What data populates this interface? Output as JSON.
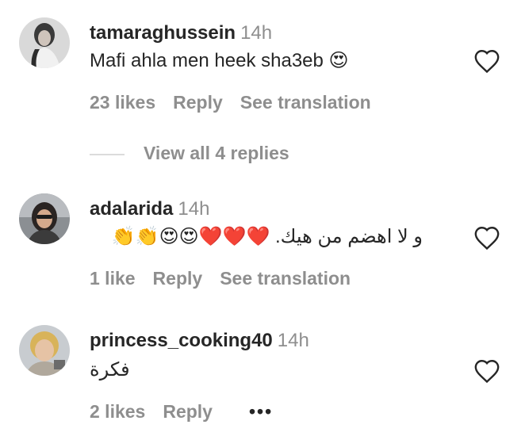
{
  "comments": [
    {
      "username": "tamaraghussein",
      "time": "14h",
      "text": "Mafi ahla men heek sha3eb 😍",
      "likes": "23 likes",
      "reply": "Reply",
      "translate": "See translation"
    },
    {
      "username": "adalarida",
      "time": "14h",
      "text": "و لا اهضم من هيك. ❤️❤️❤️😍😍👏👏",
      "likes": "1 like",
      "reply": "Reply",
      "translate": "See translation"
    },
    {
      "username": "princess_cooking40",
      "time": "14h",
      "text": "فكرة",
      "likes": "2 likes",
      "reply": "Reply",
      "more": "•••"
    }
  ],
  "view_replies": "View all 4 replies",
  "icons": {
    "heart": "heart-outline-icon",
    "more": "more-options-icon"
  },
  "colors": {
    "text": "#262626",
    "secondary": "#8e8e8e",
    "divider": "#dbdbdb"
  }
}
